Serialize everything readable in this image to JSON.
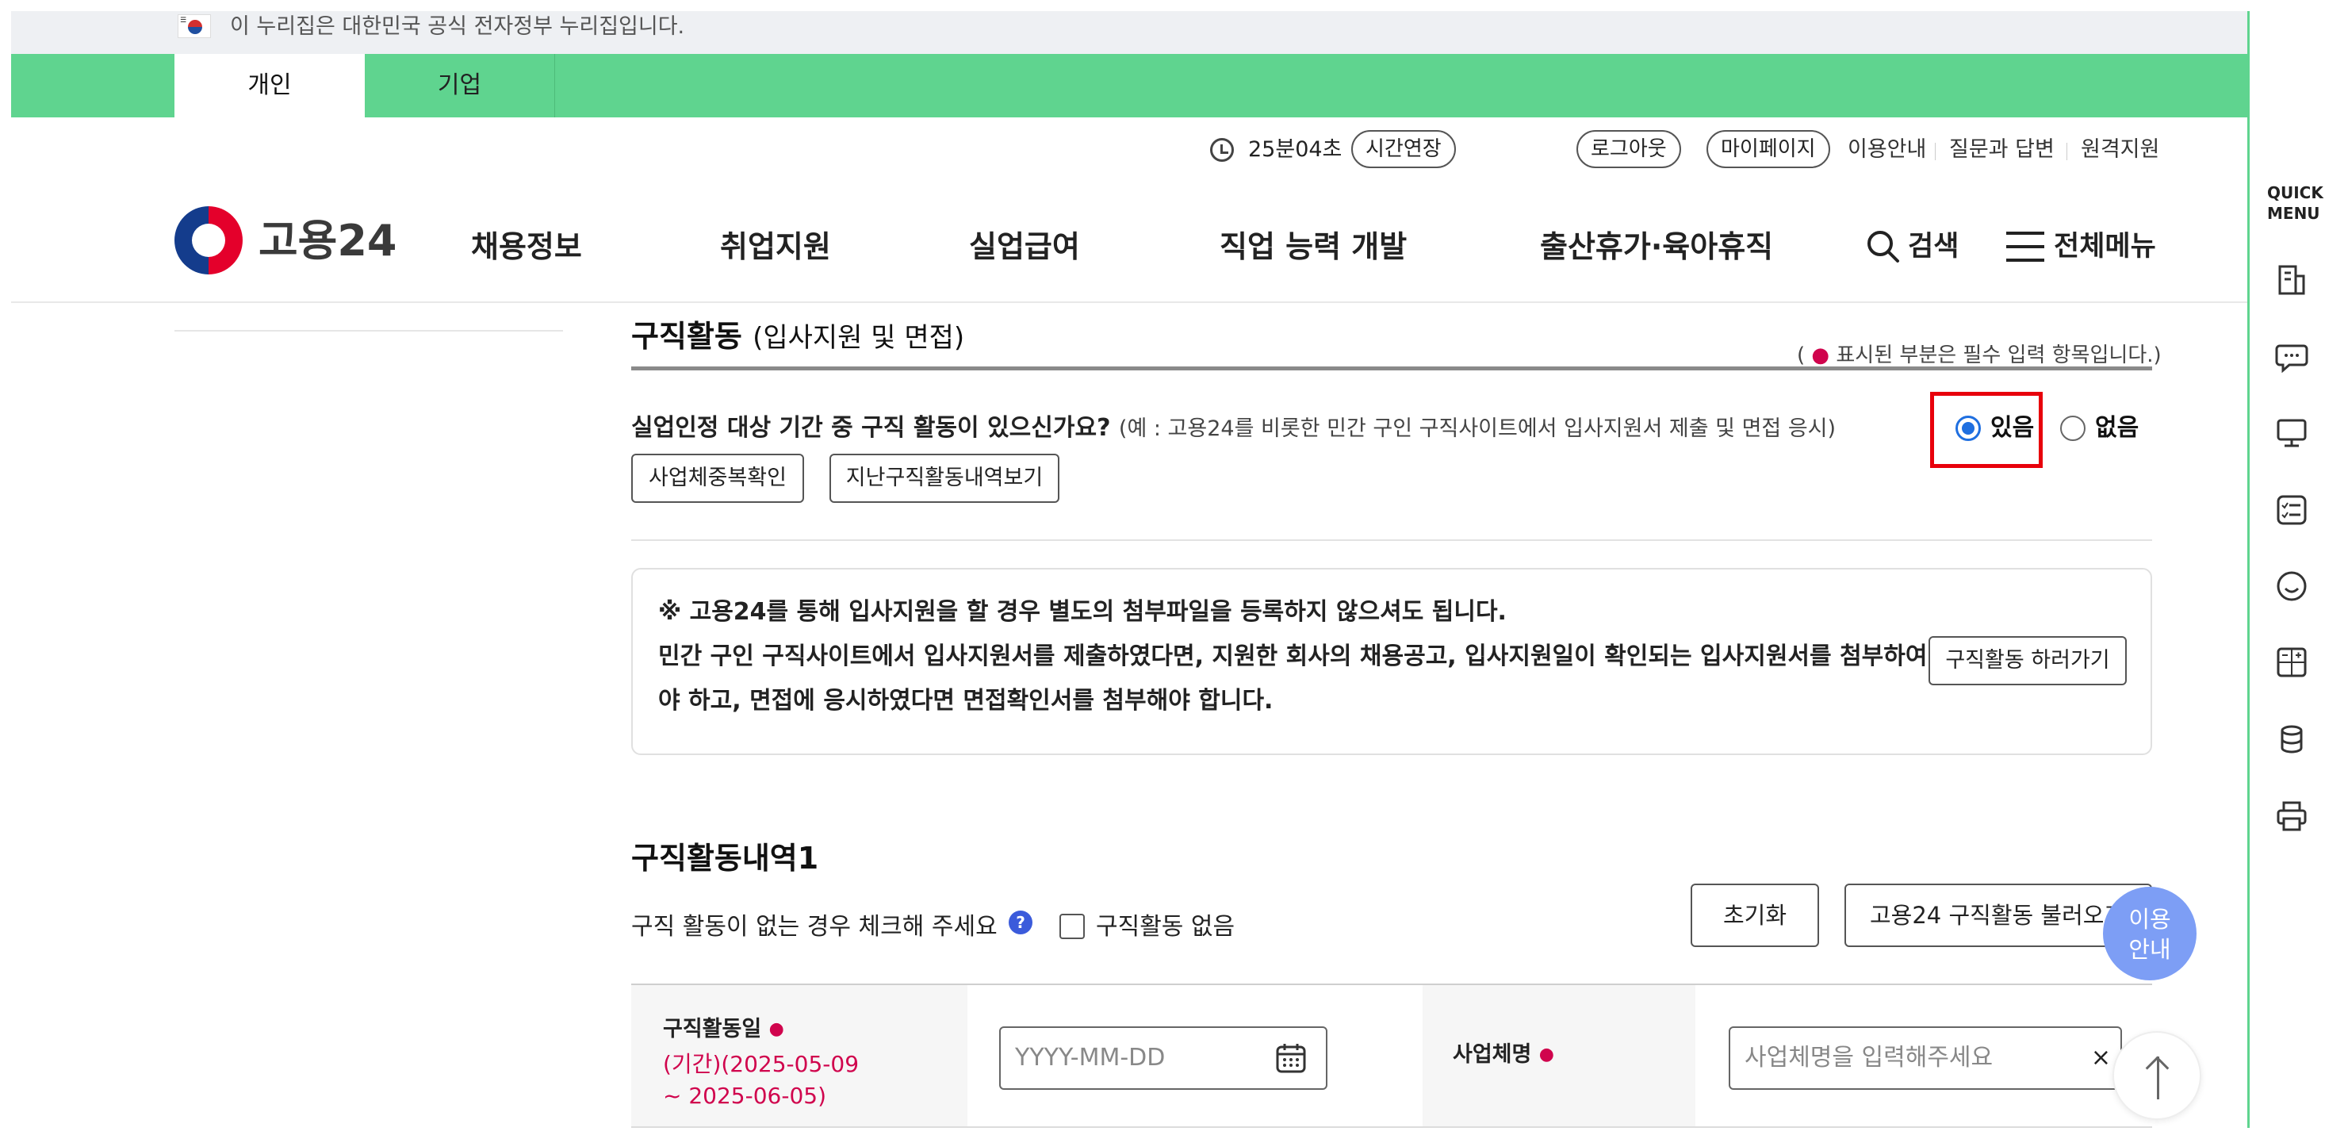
{
  "gov_banner": {
    "text": "이 누리집은 대한민국 공식 전자정부 누리집입니다."
  },
  "user_tabs": [
    {
      "label": "개인"
    },
    {
      "label": "기업"
    }
  ],
  "utility": {
    "session_time": "25분04초",
    "extend_label": "시간연장",
    "logout_label": "로그아웃",
    "mypage_label": "마이페이지",
    "links": [
      "이용안내",
      "질문과 답변",
      "원격지원"
    ]
  },
  "logo": {
    "text": "고용24"
  },
  "gnb": [
    "채용정보",
    "취업지원",
    "실업급여",
    "직업 능력 개발",
    "출산휴가·육아휴직"
  ],
  "header_actions": {
    "search": "검색",
    "menu": "전체메뉴"
  },
  "section": {
    "title": "구직활동",
    "subtitle": "(입사지원 및 면접)",
    "required_note_prefix": "(",
    "required_dot": "●",
    "required_note": "표시된 부분은 필수 입력 항목입니다.)"
  },
  "question": {
    "text": "실업인정 대상 기간 중 구직 활동이 있으신가요?",
    "example": "(예 : 고용24를 비롯한 민간 구인 구직사이트에서 입사지원서 제출 및 면접 응시)",
    "options": [
      {
        "label": "있음",
        "checked": true
      },
      {
        "label": "없음",
        "checked": false
      }
    ]
  },
  "buttons": {
    "dup_check": "사업체중복확인",
    "history": "지난구직활동내역보기",
    "go_activity": "구직활동 하러가기",
    "reset": "초기화",
    "load_activity": "고용24 구직활동 불러오기"
  },
  "notice": {
    "line1": "※ 고용24를 통해 입사지원을 할 경우 별도의 첨부파일을 등록하지 않으셔도 됩니다.",
    "line2": "민간 구인 구직사이트에서 입사지원서를 제출하였다면, 지원한 회사의 채용공고, 입사지원일이 확인되는 입사지원서를 첨부하여",
    "line3": "야 하고, 면접에 응시하였다면 면접확인서를 첨부해야 합니다."
  },
  "history_section": {
    "title": "구직활동내역1",
    "no_activity_hint": "구직 활동이 없는 경우 체크해 주세요",
    "help": "?",
    "no_activity_checkbox": "구직활동 없음"
  },
  "form": {
    "date_label": "구직활동일",
    "period_line1": "(기간)(2025-05-09",
    "period_line2": "~ 2025-06-05)",
    "date_placeholder": "YYYY-MM-DD",
    "company_label": "사업체명",
    "company_placeholder": "사업체명을 입력해주세요",
    "clear": "×"
  },
  "floating": {
    "guide_line1": "이용",
    "guide_line2": "안내"
  },
  "quick_menu": {
    "title_line1": "QUICK",
    "title_line2": "MENU"
  },
  "colors": {
    "green": "#5fd48f",
    "required": "#d0044d",
    "highlight": "#e8000b",
    "accent_blue": "#1f6fe0"
  }
}
